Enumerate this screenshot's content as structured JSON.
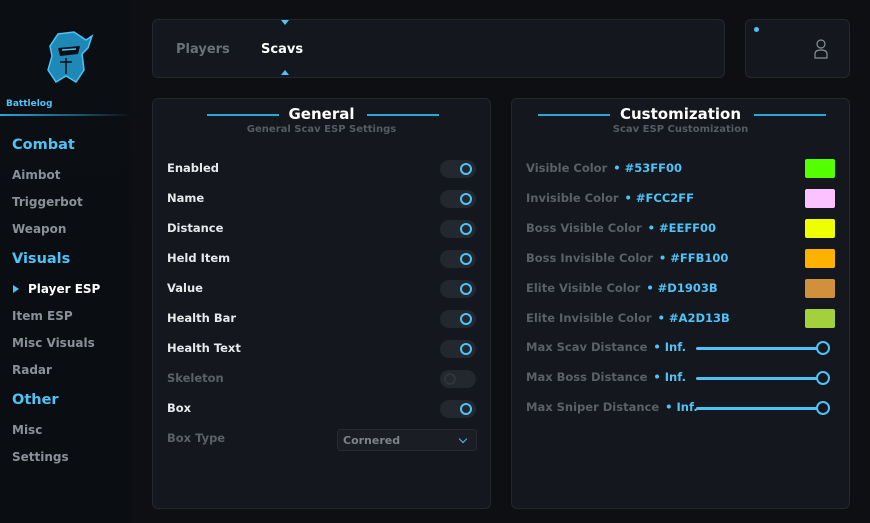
{
  "brand": "Battlelog",
  "nav": {
    "combat_heading": "Combat",
    "aimbot": "Aimbot",
    "triggerbot": "Triggerbot",
    "weapon": "Weapon",
    "visuals_heading": "Visuals",
    "player_esp": "Player ESP",
    "item_esp": "Item ESP",
    "misc_visuals": "Misc Visuals",
    "radar": "Radar",
    "other_heading": "Other",
    "misc": "Misc",
    "settings": "Settings"
  },
  "tabs": {
    "players": "Players",
    "scavs": "Scavs"
  },
  "general": {
    "title": "General",
    "subtitle": "General Scav ESP Settings",
    "rows": [
      {
        "label": "Enabled",
        "on": true
      },
      {
        "label": "Name",
        "on": true
      },
      {
        "label": "Distance",
        "on": true
      },
      {
        "label": "Held Item",
        "on": true
      },
      {
        "label": "Value",
        "on": true
      },
      {
        "label": "Health Bar",
        "on": true
      },
      {
        "label": "Health Text",
        "on": true
      },
      {
        "label": "Skeleton",
        "on": false
      },
      {
        "label": "Box",
        "on": true
      }
    ],
    "box_type_label": "Box Type",
    "box_type_value": "Cornered"
  },
  "custom": {
    "title": "Customization",
    "subtitle": "Scav ESP Customization",
    "colors": [
      {
        "label": "Visible Color",
        "value": "#53FF00",
        "hex": "#53ff00"
      },
      {
        "label": "Invisible Color",
        "value": "#FCC2FF",
        "hex": "#fcc2ff"
      },
      {
        "label": "Boss Visible Color",
        "value": "#EEFF00",
        "hex": "#eeff00"
      },
      {
        "label": "Boss Invisible Color",
        "value": "#FFB100",
        "hex": "#ffb100"
      },
      {
        "label": "Elite Visible Color",
        "value": "#D1903B",
        "hex": "#d1903b"
      },
      {
        "label": "Elite Invisible Color",
        "value": "#A2D13B",
        "hex": "#a2d13b"
      }
    ],
    "sliders": [
      {
        "label": "Max Scav Distance",
        "value": "Inf."
      },
      {
        "label": "Max Boss Distance",
        "value": "Inf."
      },
      {
        "label": "Max Sniper Distance",
        "value": "Inf."
      }
    ]
  },
  "colors": {
    "accent": "#4fc3f7"
  }
}
